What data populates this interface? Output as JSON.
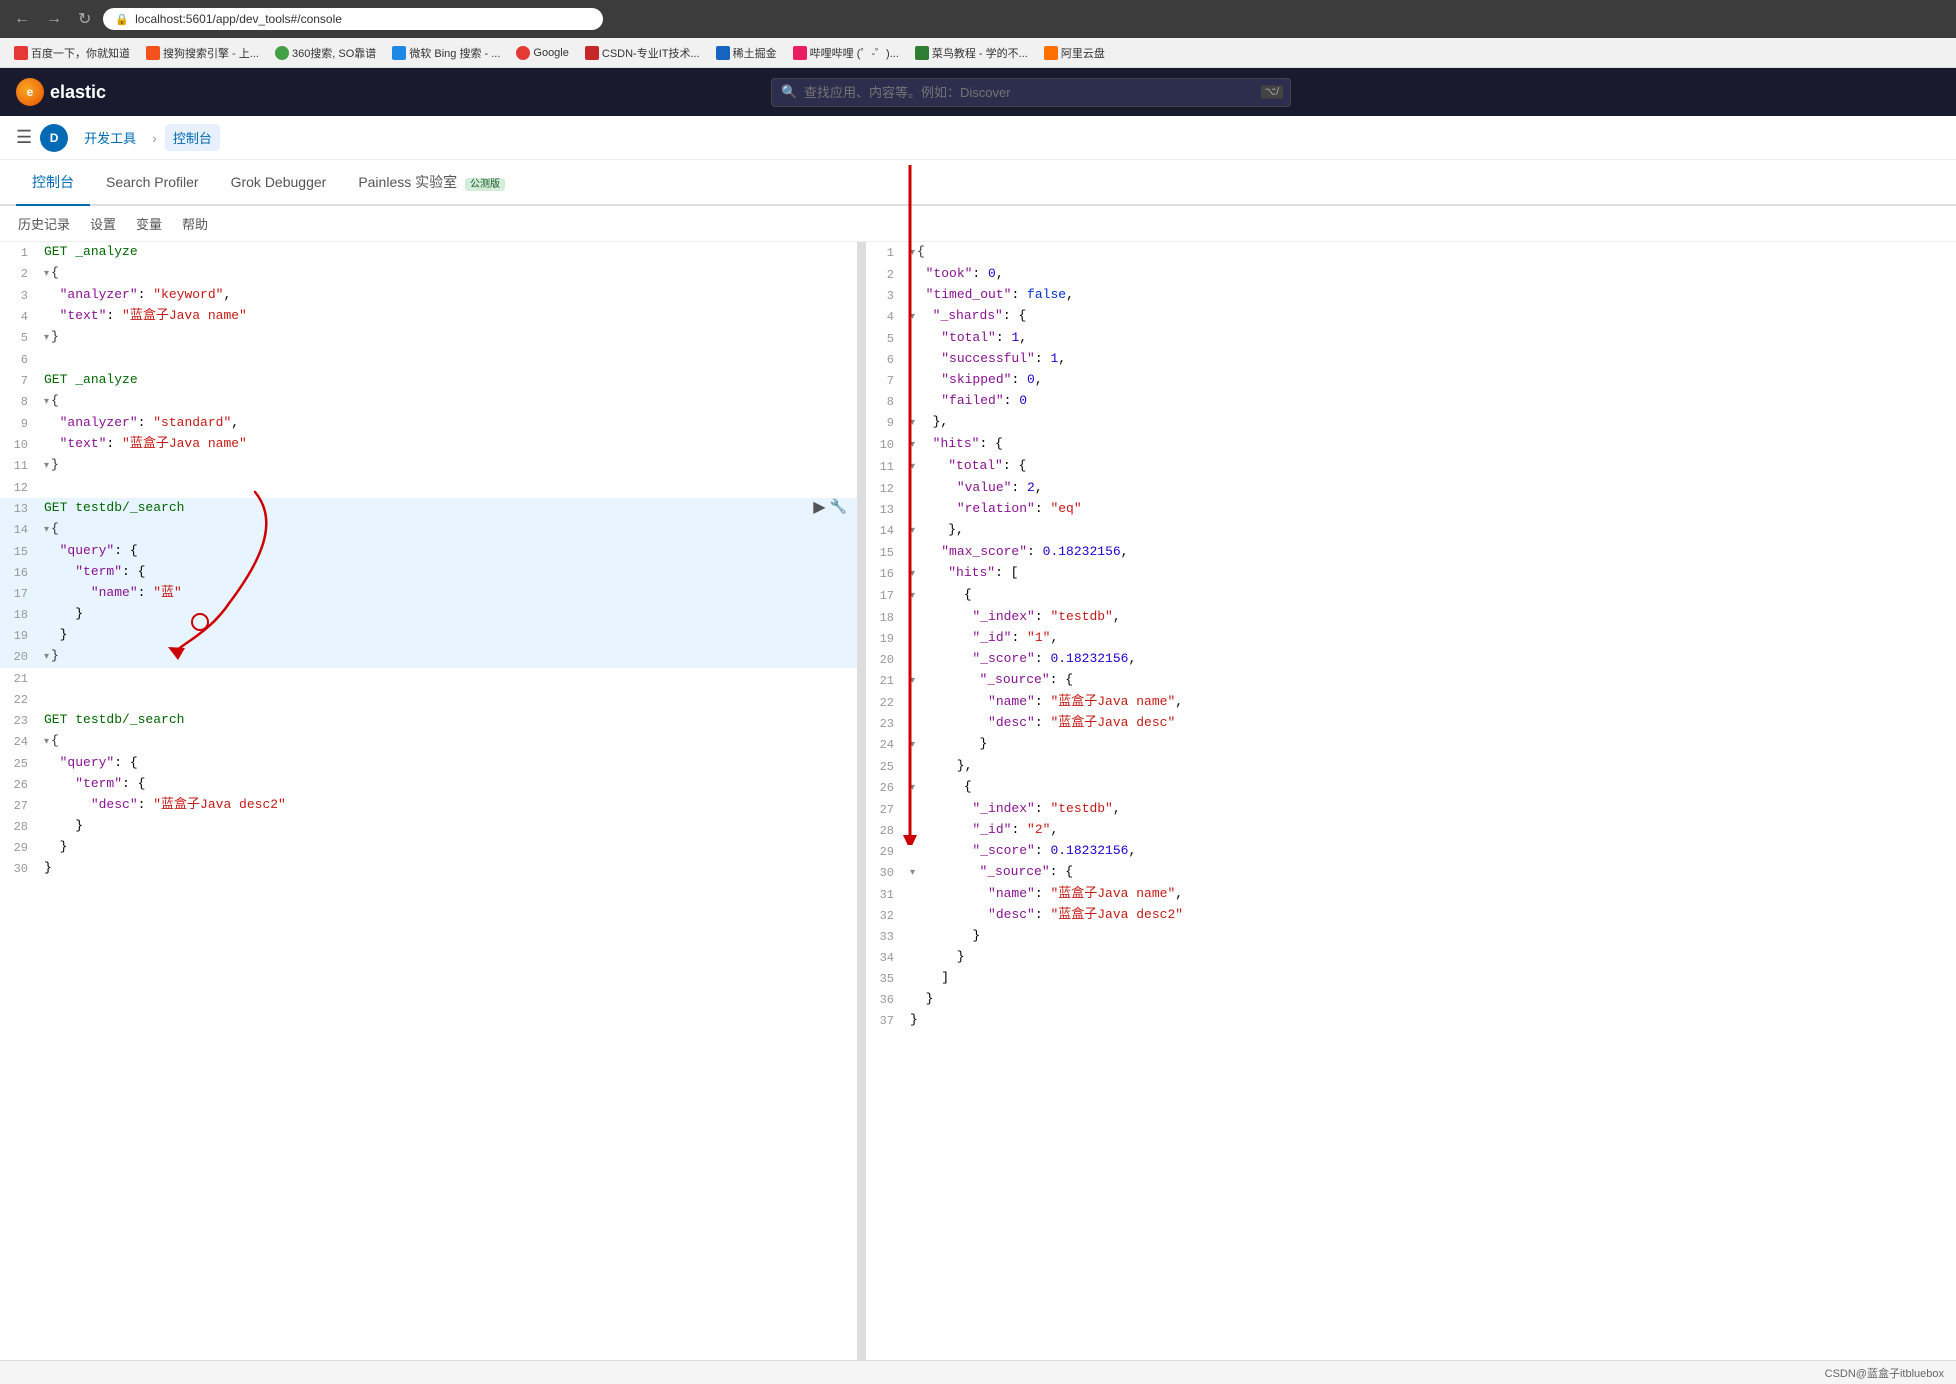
{
  "browser": {
    "back_btn": "←",
    "forward_btn": "→",
    "refresh_btn": "↻",
    "url": "localhost:5601/app/dev_tools#/console",
    "lock_icon": "🔒"
  },
  "bookmarks": [
    {
      "label": "百度一下，你就知道",
      "color": "#e53935"
    },
    {
      "label": "搜狗搜索引擎 - 上...",
      "color": "#f4511e"
    },
    {
      "label": "360搜索, SO靠谱",
      "color": "#43a047"
    },
    {
      "label": "微软 Bing 搜索 - ...",
      "color": "#1e88e5"
    },
    {
      "label": "Google",
      "color": "#e53935"
    },
    {
      "label": "CSDN-专业IT技术...",
      "color": "#c62828"
    },
    {
      "label": "稀土掘金",
      "color": "#1565c0"
    },
    {
      "label": "哔哩哔哩 (゜-゜)...",
      "color": "#e91e63"
    },
    {
      "label": "菜鸟教程 - 学的不...",
      "color": "#2e7d32"
    },
    {
      "label": "阿里云盘",
      "color": "#ff6f00"
    }
  ],
  "header": {
    "logo_text": "elastic",
    "search_placeholder": "查找应用、内容等。例如：Discover",
    "slash_badge": "⌥/"
  },
  "subnav": {
    "avatar_letter": "D",
    "breadcrumb1": "开发工具",
    "breadcrumb2": "控制台"
  },
  "tabs": [
    {
      "label": "控制台",
      "active": true
    },
    {
      "label": "Search Profiler",
      "active": false
    },
    {
      "label": "Grok Debugger",
      "active": false
    },
    {
      "label": "Painless 实验室",
      "active": false
    },
    {
      "label": "公测版",
      "badge": true
    }
  ],
  "toolbar": {
    "history_label": "历史记录",
    "settings_label": "设置",
    "variables_label": "变量",
    "help_label": "帮助"
  },
  "editor": {
    "lines": [
      {
        "num": 1,
        "content": "GET _analyze",
        "type": "method_line"
      },
      {
        "num": 2,
        "content": "{",
        "fold": true
      },
      {
        "num": 3,
        "content": "  \"analyzer\": \"keyword\",",
        "type": "prop_str"
      },
      {
        "num": 4,
        "content": "  \"text\": \"蓝盒子Java name\"",
        "type": "prop_str"
      },
      {
        "num": 5,
        "content": "}",
        "fold": true
      },
      {
        "num": 6,
        "content": ""
      },
      {
        "num": 7,
        "content": "GET _analyze",
        "type": "method_line"
      },
      {
        "num": 8,
        "content": "{",
        "fold": true
      },
      {
        "num": 9,
        "content": "  \"analyzer\": \"standard\",",
        "type": "prop_str"
      },
      {
        "num": 10,
        "content": "  \"text\": \"蓝盒子Java name\"",
        "type": "prop_str"
      },
      {
        "num": 11,
        "content": "}",
        "fold": true
      },
      {
        "num": 12,
        "content": ""
      },
      {
        "num": 13,
        "content": "GET testdb/_search",
        "type": "method_line",
        "highlighted": true,
        "actions": true
      },
      {
        "num": 14,
        "content": "{",
        "fold": true,
        "highlighted": true
      },
      {
        "num": 15,
        "content": "  \"query\": {",
        "highlighted": true
      },
      {
        "num": 16,
        "content": "    \"term\": {",
        "highlighted": true
      },
      {
        "num": 17,
        "content": "      \"name\": \"蓝\"",
        "highlighted": true
      },
      {
        "num": 18,
        "content": "    }",
        "highlighted": true
      },
      {
        "num": 19,
        "content": "  }",
        "highlighted": true
      },
      {
        "num": 20,
        "content": "}",
        "fold": true,
        "highlighted": true
      },
      {
        "num": 21,
        "content": ""
      },
      {
        "num": 22,
        "content": ""
      },
      {
        "num": 23,
        "content": "GET testdb/_search",
        "type": "method_line"
      },
      {
        "num": 24,
        "content": "{",
        "fold": true
      },
      {
        "num": 25,
        "content": "  \"query\": {"
      },
      {
        "num": 26,
        "content": "    \"term\": {"
      },
      {
        "num": 27,
        "content": "      \"desc\": \"蓝盒子Java desc2\""
      },
      {
        "num": 28,
        "content": "    }"
      },
      {
        "num": 29,
        "content": "  }"
      },
      {
        "num": 30,
        "content": "}"
      }
    ]
  },
  "result": {
    "lines": [
      {
        "num": 1,
        "content": "{",
        "fold": true
      },
      {
        "num": 2,
        "content": "  \"took\": 0,"
      },
      {
        "num": 3,
        "content": "  \"timed_out\": false,"
      },
      {
        "num": 4,
        "content": "  \"_shards\": {",
        "fold": true
      },
      {
        "num": 5,
        "content": "    \"total\": 1,"
      },
      {
        "num": 6,
        "content": "    \"successful\": 1,"
      },
      {
        "num": 7,
        "content": "    \"skipped\": 0,"
      },
      {
        "num": 8,
        "content": "    \"failed\": 0"
      },
      {
        "num": 9,
        "content": "  },",
        "fold": true
      },
      {
        "num": 10,
        "content": "  \"hits\": {",
        "fold": true
      },
      {
        "num": 11,
        "content": "    \"total\": {",
        "fold": true
      },
      {
        "num": 12,
        "content": "      \"value\": 2,"
      },
      {
        "num": 13,
        "content": "      \"relation\": \"eq\""
      },
      {
        "num": 14,
        "content": "    },",
        "fold": true
      },
      {
        "num": 15,
        "content": "    \"max_score\": 0.18232156,"
      },
      {
        "num": 16,
        "content": "    \"hits\": [",
        "fold": true
      },
      {
        "num": 17,
        "content": "      {",
        "fold": true
      },
      {
        "num": 18,
        "content": "        \"_index\": \"testdb\","
      },
      {
        "num": 19,
        "content": "        \"_id\": \"1\","
      },
      {
        "num": 20,
        "content": "        \"_score\": 0.18232156,"
      },
      {
        "num": 21,
        "content": "        \"_source\": {",
        "fold": true
      },
      {
        "num": 22,
        "content": "          \"name\": \"蓝盒子Java name\","
      },
      {
        "num": 23,
        "content": "          \"desc\": \"蓝盒子Java desc\""
      },
      {
        "num": 24,
        "content": "        }",
        "fold": true
      },
      {
        "num": 25,
        "content": "      },"
      },
      {
        "num": 26,
        "content": "      {",
        "fold": true
      },
      {
        "num": 27,
        "content": "        \"_index\": \"testdb\","
      },
      {
        "num": 28,
        "content": "        \"_id\": \"2\","
      },
      {
        "num": 29,
        "content": "        \"_score\": 0.18232156,"
      },
      {
        "num": 30,
        "content": "        \"_source\": {",
        "fold": true
      },
      {
        "num": 31,
        "content": "          \"name\": \"蓝盒子Java name\","
      },
      {
        "num": 32,
        "content": "          \"desc\": \"蓝盒子Java desc2\""
      },
      {
        "num": 33,
        "content": "        }"
      },
      {
        "num": 34,
        "content": "      }"
      },
      {
        "num": 35,
        "content": "    ]"
      },
      {
        "num": 36,
        "content": "  }"
      },
      {
        "num": 37,
        "content": "}"
      }
    ]
  },
  "statusbar": {
    "text": "CSDN@蓝盒子itbluebox"
  }
}
